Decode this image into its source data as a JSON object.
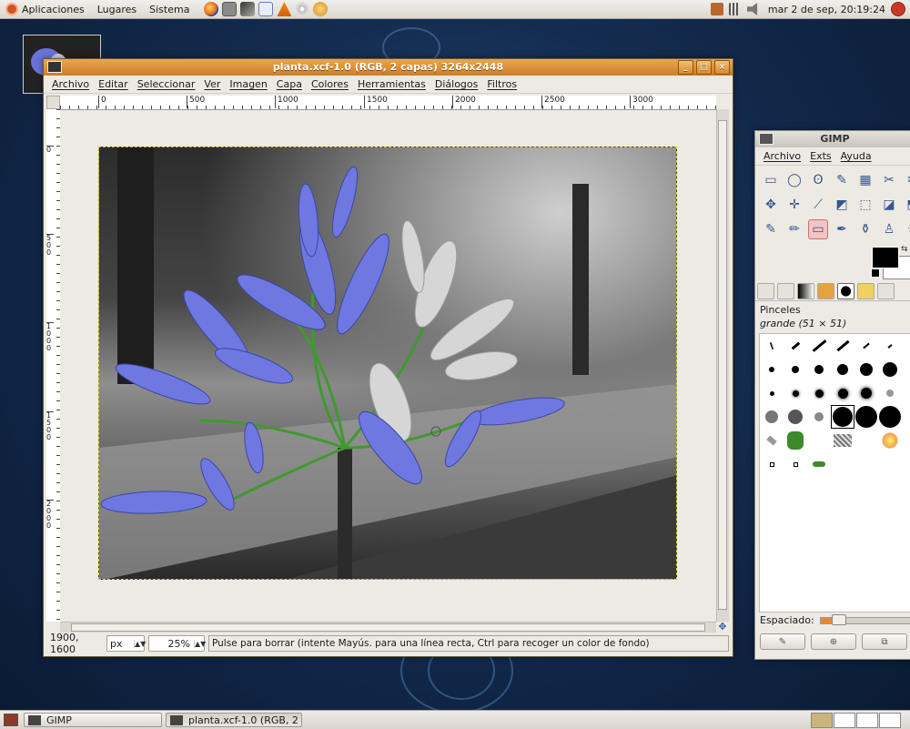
{
  "top_panel": {
    "menus": [
      "Aplicaciones",
      "Lugares",
      "Sistema"
    ],
    "launchers": [
      "firefox-icon",
      "screenshot-icon",
      "network-icon",
      "snowflake-icon",
      "vlc-icon",
      "cd-icon",
      "app-icon"
    ],
    "clock": "mar  2 de sep, 20:19:24"
  },
  "image_window": {
    "title": "planta.xcf-1.0 (RGB, 2 capas) 3264x2448",
    "buttons": [
      "_",
      "□",
      "×"
    ],
    "menu": [
      "Archivo",
      "Editar",
      "Seleccionar",
      "Ver",
      "Imagen",
      "Capa",
      "Colores",
      "Herramientas",
      "Diálogos",
      "Filtros"
    ],
    "ruler_h_labels": [
      "0",
      "500",
      "1000",
      "1500",
      "2000",
      "2500",
      "3000"
    ],
    "ruler_v_labels": [
      "0",
      "500",
      "1000",
      "1500",
      "2000"
    ],
    "status": {
      "coords": "1900, 1600",
      "unit": "px",
      "zoom": "25%",
      "message": "Pulse para borrar (intente Mayús. para una línea recta, Ctrl para recoger un color de fondo)"
    }
  },
  "toolbox": {
    "title": "GIMP",
    "menu": [
      "Archivo",
      "Exts",
      "Ayuda"
    ],
    "tools": [
      "▭",
      "◯",
      "ʘ",
      "✎",
      "▦",
      "✂",
      "✂",
      "✥",
      "✛",
      "⟋",
      "◩",
      "⬚",
      "◪",
      "⬒",
      "✎",
      "✏",
      "▭",
      "✒",
      "⚱",
      "♙",
      "☀"
    ],
    "active_tool_index": 16,
    "fg_color": "#000000",
    "bg_color": "#ffffff",
    "brushes_title": "Pinceles",
    "brush_name": "grande (51 × 51)",
    "spacing_label": "Espaciado:"
  },
  "taskbar": {
    "tasks": [
      "GIMP",
      "planta.xcf-1.0 (RGB, 2 ..."
    ]
  }
}
